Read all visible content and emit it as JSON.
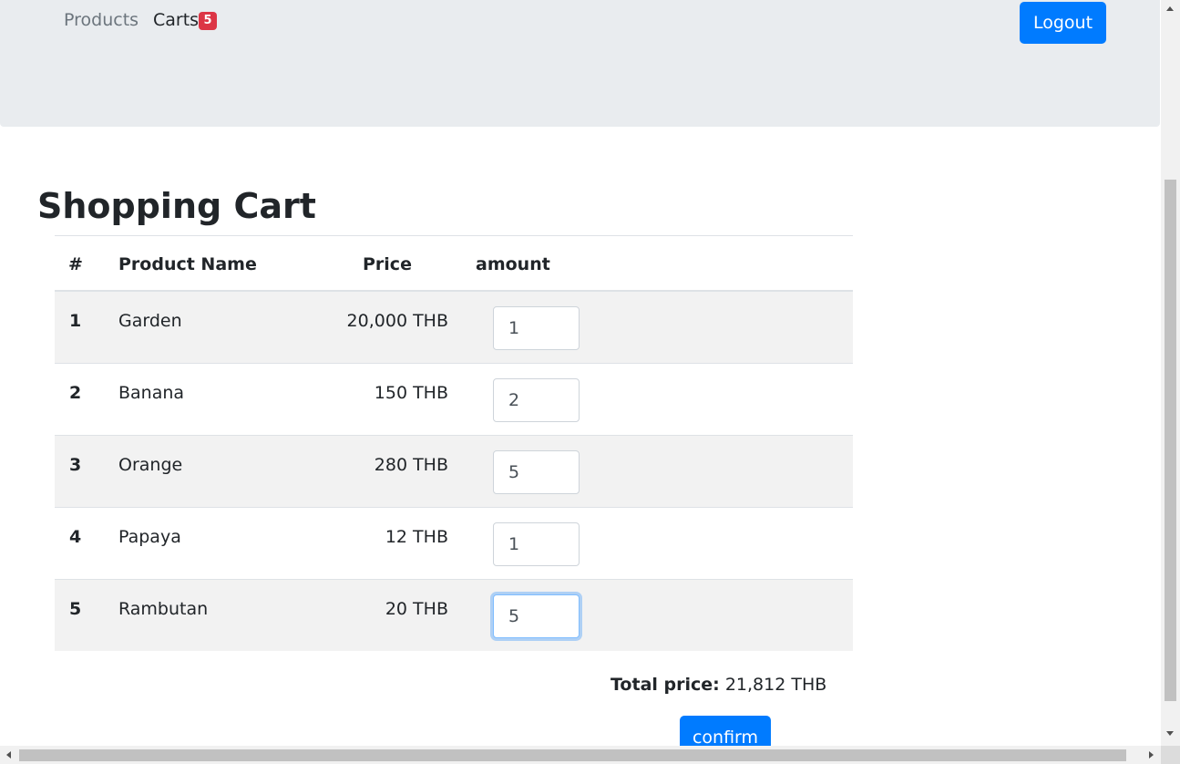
{
  "nav": {
    "products_label": "Products",
    "carts_label": "Carts",
    "cart_count": "5",
    "logout_label": "Logout"
  },
  "page": {
    "title": "Shopping Cart"
  },
  "table": {
    "headers": {
      "num": "#",
      "name": "Product Name",
      "price": "Price",
      "amount": "amount"
    },
    "rows": [
      {
        "num": "1",
        "name": "Garden",
        "price": "20,000 THB",
        "amount": "1"
      },
      {
        "num": "2",
        "name": "Banana",
        "price": "150 THB",
        "amount": "2"
      },
      {
        "num": "3",
        "name": "Orange",
        "price": "280 THB",
        "amount": "5"
      },
      {
        "num": "4",
        "name": "Papaya",
        "price": "12 THB",
        "amount": "1"
      },
      {
        "num": "5",
        "name": "Rambutan",
        "price": "20 THB",
        "amount": "5"
      }
    ]
  },
  "summary": {
    "total_label": "Total price:",
    "total_value": "21,812 THB",
    "confirm_label": "confirm"
  },
  "colors": {
    "primary": "#007bff",
    "badge": "#dc3545",
    "navbar_bg": "#e9ecef",
    "striped_row": "#f2f2f2"
  }
}
